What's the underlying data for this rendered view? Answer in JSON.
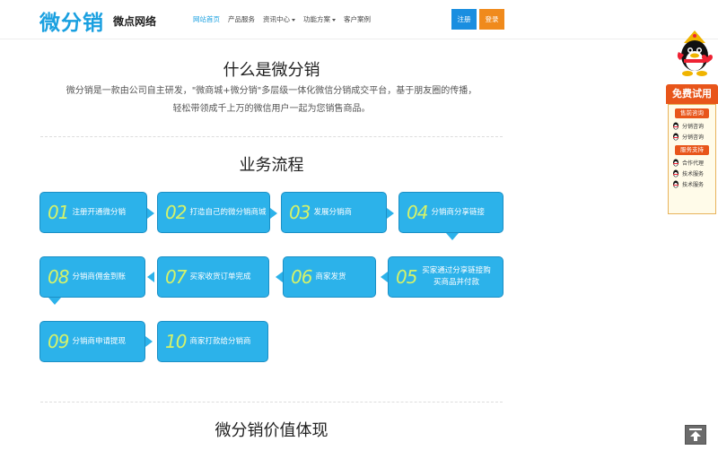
{
  "header": {
    "logo_text": "微分销",
    "logo_sub": "微点网络",
    "nav": [
      {
        "label": "网站首页",
        "active": true,
        "dropdown": false
      },
      {
        "label": "产品服务",
        "active": false,
        "dropdown": false
      },
      {
        "label": "资讯中心",
        "active": false,
        "dropdown": true
      },
      {
        "label": "功能方案",
        "active": false,
        "dropdown": true
      },
      {
        "label": "客户案例",
        "active": false,
        "dropdown": false
      }
    ],
    "register_label": "注册",
    "login_label": "登录"
  },
  "section1": {
    "title": "什么是微分销",
    "intro_line1": "微分销是一款由公司自主研发，\"微商城+微分销\"多层级一体化微信分销成交平台，基于朋友圈的传播，",
    "intro_line2": "轻松带领成千上万的微信用户一起为您销售商品。"
  },
  "section2": {
    "title": "业务流程",
    "steps": [
      {
        "num": "01",
        "label": "注册开通微分销"
      },
      {
        "num": "02",
        "label": "打造自己的微分销商城"
      },
      {
        "num": "03",
        "label": "发展分销商"
      },
      {
        "num": "04",
        "label": "分销商分享链接"
      },
      {
        "num": "05",
        "label": "买家通过分享链接购买商品并付款"
      },
      {
        "num": "06",
        "label": "商家发货"
      },
      {
        "num": "07",
        "label": "买家收货订单完成"
      },
      {
        "num": "08",
        "label": "分销商佣金到账"
      },
      {
        "num": "09",
        "label": "分销商申请提现"
      },
      {
        "num": "10",
        "label": "商家打款给分销商"
      }
    ]
  },
  "section3": {
    "title": "微分销价值体现"
  },
  "side_widget": {
    "free_trial": "免费试用",
    "presale_header": "售前咨询",
    "presale_items": [
      "分销咨询",
      "分销咨询"
    ],
    "support_header": "服务支持",
    "support_items": [
      "合作代理",
      "技术服务",
      "技术服务"
    ]
  },
  "colors": {
    "brand": "#1aa0e0",
    "step_bg": "#2cb2ea",
    "step_num": "#d4f26a",
    "login_btn": "#f08a1c",
    "trial": "#e8551a"
  }
}
